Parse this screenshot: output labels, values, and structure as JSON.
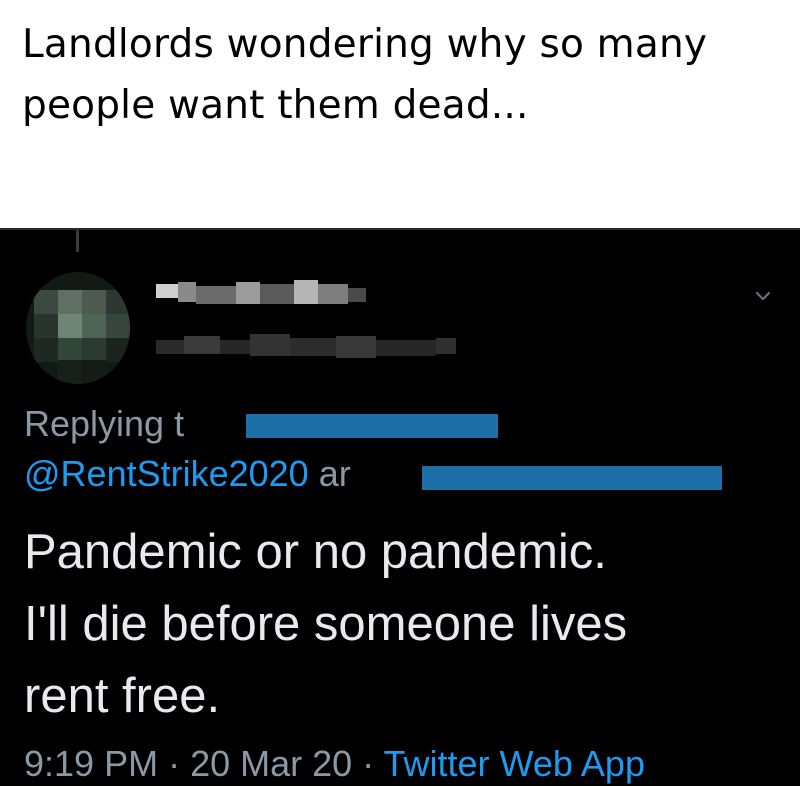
{
  "caption": {
    "line1": "Landlords wondering why so many",
    "line2": "people want them dead..."
  },
  "tweet": {
    "author_name": "",
    "author_handle": "",
    "replying_prefix": "Replying t",
    "mention_handle": "@RentStrike2020",
    "mention_suffix": " ar",
    "text_line1": "Pandemic or no pandemic.",
    "text_line2": "I'll die before someone lives",
    "text_line3": "rent free.",
    "time": "9:19 PM",
    "separator": " · ",
    "date": "20 Mar 20",
    "source": "Twitter Web App",
    "menu_icon": "chevron-down-icon"
  },
  "colors": {
    "background_dark": "#000000",
    "text_primary": "#e8eaed",
    "text_secondary": "#8b98a5",
    "link": "#1d9bf0"
  }
}
